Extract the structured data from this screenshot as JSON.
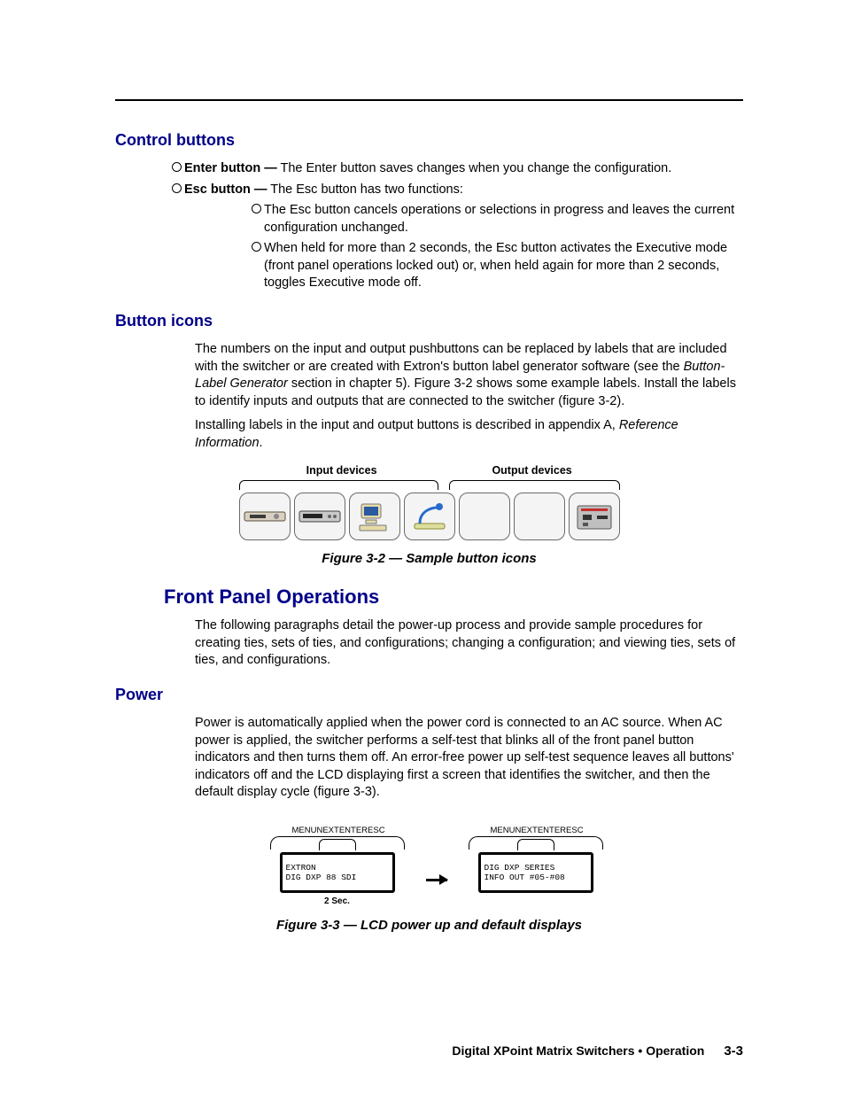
{
  "headings": {
    "control_buttons": "Control buttons",
    "button_icons": "Button icons",
    "front_panel_ops": "Front Panel Operations",
    "power": "Power"
  },
  "bullets": {
    "enter": {
      "label": "Enter button —",
      "text": "The Enter button saves changes when you change the configuration."
    },
    "esc_label": "Esc button —",
    "esc_text": "The Esc button has two functions:",
    "esc_sub1": "The Esc button cancels operations or selections in progress and leaves the current configuration unchanged.",
    "esc_sub2": "When held for more than 2 seconds, the Esc button activates the Executive mode (front panel operations locked out) or, when held again for more than 2 seconds, toggles Executive mode off."
  },
  "button_icons_section": {
    "p1a": "The numbers on the input and output pushbuttons can be replaced by labels that are included with the switcher or are created with Extron's button label generator software (see the ",
    "p1_em": "Button-Label Generator",
    "p1b": " section in chapter 5). Figure 3-2 shows some example labels. Install the labels to identify inputs and outputs that are connected to the switcher (figure 3-2).",
    "p2a": "Installing labels in the input and output buttons is described in appendix A, ",
    "p2_em": "Reference Information",
    "p2b": ".",
    "fig32_left": "Input devices",
    "fig32_right": "Output devices",
    "fig32_caption": "Figure 3-2 — Sample button icons"
  },
  "front_panel_section": {
    "p1": "The following paragraphs detail the power-up process and provide sample procedures for creating ties, sets of ties, and configurations; changing a configuration; and viewing ties, sets of ties, and configurations."
  },
  "power_section": {
    "p1": "Power is automatically applied when the power cord is connected to an AC source. When AC power is applied, the switcher performs a self-test that blinks all of the front panel button indicators and then turns them off. An error-free power up self-test sequence leaves all buttons' indicators off and the LCD displaying first a screen that identifies the switcher, and then the default display cycle (figure 3-3).",
    "fig33": {
      "tick_labels": [
        "MENU",
        "NEXT",
        "ENTER",
        "ESC"
      ],
      "lcd1_line1": "EXTRON",
      "lcd1_line2": "DIG DXP 88 SDI",
      "lcd2_line1": "DIG DXP SERIES",
      "lcd2_line2": "INFO OUT #05-#08",
      "time_label": "2 Sec.",
      "caption": "Figure 3-3 — LCD power up and default displays"
    }
  },
  "footer": {
    "title": "Digital XPoint Matrix Switchers • Operation",
    "page": "3-3"
  }
}
